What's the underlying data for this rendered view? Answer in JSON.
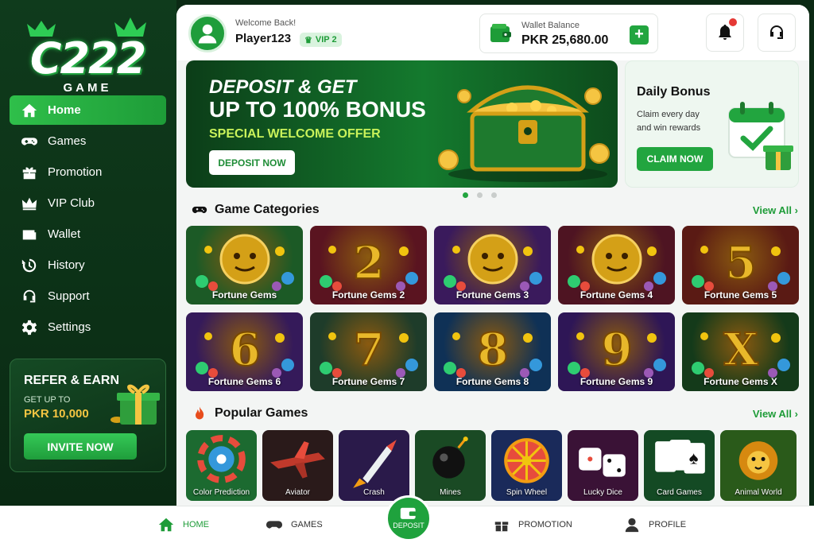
{
  "logo": {
    "brand": "C222",
    "sub": "GAME"
  },
  "sidebar": {
    "items": [
      {
        "label": "Home",
        "icon": "home-icon",
        "active": true
      },
      {
        "label": "Games",
        "icon": "gamepad-icon"
      },
      {
        "label": "Promotion",
        "icon": "gift-icon"
      },
      {
        "label": "VIP Club",
        "icon": "crown-icon"
      },
      {
        "label": "Wallet",
        "icon": "wallet-icon"
      },
      {
        "label": "History",
        "icon": "history-icon"
      },
      {
        "label": "Support",
        "icon": "headset-icon"
      },
      {
        "label": "Settings",
        "icon": "gear-icon"
      }
    ]
  },
  "refer": {
    "title": "REFER & EARN",
    "get_up_to": "GET UP TO",
    "amount": "PKR 10,000",
    "button": "INVITE NOW"
  },
  "header": {
    "welcome": "Welcome Back!",
    "player": "Player123",
    "vip": "VIP 2",
    "wallet_label": "Wallet Balance",
    "wallet_value": "PKR 25,680.00",
    "add_symbol": "+"
  },
  "hero": {
    "line1": "DEPOSIT & GET",
    "line2": "UP TO 100% BONUS",
    "line3": "SPECIAL WELCOME OFFER",
    "button": "DEPOSIT NOW"
  },
  "daily": {
    "title": "Daily Bonus",
    "desc": "Claim every day and win rewards",
    "button": "CLAIM NOW"
  },
  "carousel": {
    "count": 3,
    "active": 0
  },
  "categories": {
    "title": "Game Categories",
    "view_all": "View All",
    "items": [
      {
        "label": "Fortune Gems",
        "bg": "#1c5a26",
        "glyph": ""
      },
      {
        "label": "Fortune Gems 2",
        "bg": "#5a1420",
        "glyph": "2"
      },
      {
        "label": "Fortune Gems 3",
        "bg": "#3a1a5c",
        "glyph": ""
      },
      {
        "label": "Fortune Gems 4",
        "bg": "#4e1422",
        "glyph": ""
      },
      {
        "label": "Fortune Gems 5",
        "bg": "#5a1a14",
        "glyph": "5"
      },
      {
        "label": "Fortune Gems 6",
        "bg": "#351a5a",
        "glyph": "6"
      },
      {
        "label": "Fortune Gems 7",
        "bg": "#1e3c2a",
        "glyph": "7"
      },
      {
        "label": "Fortune Gems 8",
        "bg": "#0f3156",
        "glyph": "8"
      },
      {
        "label": "Fortune Gems 9",
        "bg": "#2e1656",
        "glyph": "9"
      },
      {
        "label": "Fortune Gems X",
        "bg": "#143a1a",
        "glyph": "X"
      }
    ]
  },
  "popular": {
    "title": "Popular Games",
    "view_all": "View All",
    "items": [
      {
        "label": "Color Prediction",
        "bg": "#1c6a30"
      },
      {
        "label": "Aviator",
        "bg": "#2a1a1a"
      },
      {
        "label": "Crash",
        "bg": "#2a1a4a"
      },
      {
        "label": "Mines",
        "bg": "#1a4a24"
      },
      {
        "label": "Spin Wheel",
        "bg": "#1a2a5a"
      },
      {
        "label": "Lucky Dice",
        "bg": "#3a1236"
      },
      {
        "label": "Card Games",
        "bg": "#144a24"
      },
      {
        "label": "Animal World",
        "bg": "#2a5a1a"
      }
    ]
  },
  "bottomnav": {
    "home": "HOME",
    "games": "GAMES",
    "deposit": "DEPOSIT",
    "promotion": "PROMOTION",
    "profile": "PROFILE"
  },
  "colors": {
    "accent": "#22a53f",
    "dark": "#0b2a14",
    "gold": "#f5c542"
  }
}
